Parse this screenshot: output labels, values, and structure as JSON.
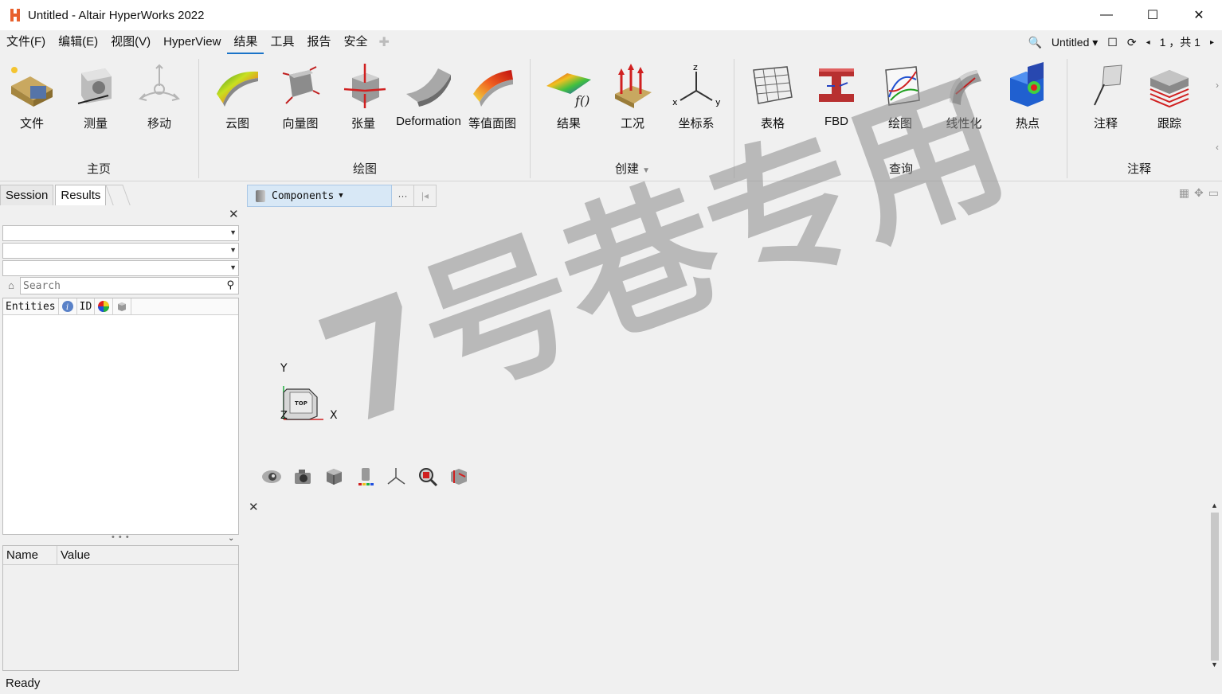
{
  "titlebar": {
    "title": "Untitled - Altair HyperWorks 2022",
    "minimize": "—",
    "maximize": "☐",
    "close": "✕"
  },
  "menu": {
    "items": [
      "文件(F)",
      "编辑(E)",
      "视图(V)",
      "HyperView",
      "结果",
      "工具",
      "报告",
      "安全"
    ],
    "active": "结果",
    "right": {
      "session": "Untitled",
      "page_text": "1 ，共 1"
    }
  },
  "ribbon": {
    "groups": [
      {
        "label": "主页",
        "tools": [
          "文件",
          "测量",
          "移动"
        ]
      },
      {
        "label": "绘图",
        "tools": [
          "云图",
          "向量图",
          "张量",
          "Deformation",
          "等值面图"
        ]
      },
      {
        "label": "创建",
        "tools": [
          "结果",
          "工况",
          "坐标系"
        ]
      },
      {
        "label": "查询",
        "tools": [
          "表格",
          "FBD",
          "绘图",
          "线性化",
          "热点"
        ]
      },
      {
        "label": "注释",
        "tools": [
          "注释",
          "跟踪"
        ]
      }
    ]
  },
  "left_panel": {
    "tabs": [
      "Session",
      "Results"
    ],
    "active_tab": "Results",
    "search_placeholder": "Search",
    "entity_columns": [
      "Entities",
      "ID"
    ],
    "props_columns": [
      "Name",
      "Value"
    ]
  },
  "viewport": {
    "components_label": "Components",
    "triad": {
      "y": "Y",
      "x": "X",
      "z": "Z",
      "face": "TOP"
    },
    "watermark": "7号巷专用"
  },
  "status": {
    "text": "Ready"
  },
  "colors": {
    "accent": "#1a73c8",
    "logo": "#e8602c",
    "comp_bg": "#d8e8f6"
  }
}
